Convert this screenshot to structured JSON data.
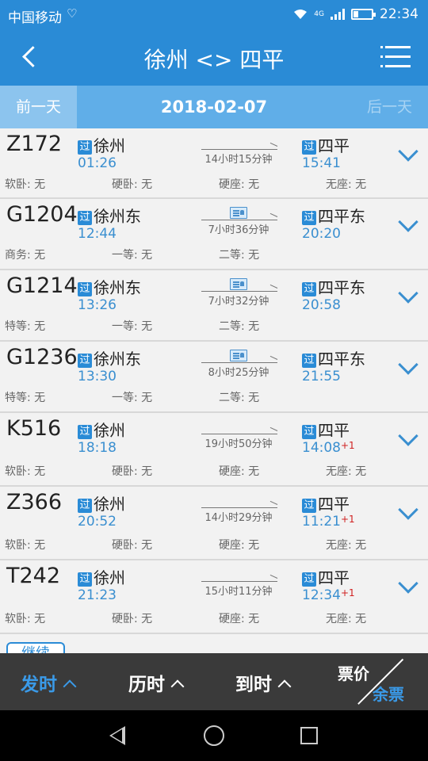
{
  "status": {
    "carrier": "中国移动",
    "net": "4G",
    "time": "22:34"
  },
  "header": {
    "title": "徐州 <> 四平"
  },
  "datebar": {
    "prev": "前一天",
    "date": "2018-02-07",
    "next": "后一天"
  },
  "badge": "过",
  "trains": [
    {
      "num": "Z172",
      "from": "徐州",
      "dep": "01:26",
      "duration": "14小时15分钟",
      "to": "四平",
      "arr": "15:41",
      "plus": "",
      "ticket_icon": false,
      "seats": [
        "软卧: 无",
        "硬卧: 无",
        "硬座: 无",
        "无座: 无"
      ]
    },
    {
      "num": "G1204",
      "from": "徐州东",
      "dep": "12:44",
      "duration": "7小时36分钟",
      "to": "四平东",
      "arr": "20:20",
      "plus": "",
      "ticket_icon": true,
      "seats": [
        "商务: 无",
        "一等: 无",
        "二等: 无",
        ""
      ]
    },
    {
      "num": "G1214",
      "from": "徐州东",
      "dep": "13:26",
      "duration": "7小时32分钟",
      "to": "四平东",
      "arr": "20:58",
      "plus": "",
      "ticket_icon": true,
      "seats": [
        "特等: 无",
        "一等: 无",
        "二等: 无",
        ""
      ]
    },
    {
      "num": "G1236",
      "from": "徐州东",
      "dep": "13:30",
      "duration": "8小时25分钟",
      "to": "四平东",
      "arr": "21:55",
      "plus": "",
      "ticket_icon": true,
      "seats": [
        "特等: 无",
        "一等: 无",
        "二等: 无",
        ""
      ]
    },
    {
      "num": "K516",
      "from": "徐州",
      "dep": "18:18",
      "duration": "19小时50分钟",
      "to": "四平",
      "arr": "14:08",
      "plus": "+1",
      "ticket_icon": false,
      "seats": [
        "软卧: 无",
        "硬卧: 无",
        "硬座: 无",
        "无座: 无"
      ]
    },
    {
      "num": "Z366",
      "from": "徐州",
      "dep": "20:52",
      "duration": "14小时29分钟",
      "to": "四平",
      "arr": "11:21",
      "plus": "+1",
      "ticket_icon": false,
      "seats": [
        "软卧: 无",
        "硬卧: 无",
        "硬座: 无",
        "无座: 无"
      ]
    },
    {
      "num": "T242",
      "from": "徐州",
      "dep": "21:23",
      "duration": "15小时11分钟",
      "to": "四平",
      "arr": "12:34",
      "plus": "+1",
      "ticket_icon": false,
      "seats": [
        "软卧: 无",
        "硬卧: 无",
        "硬座: 无",
        "无座: 无"
      ]
    }
  ],
  "more_button": "继续",
  "sort": {
    "depart": "发时",
    "duration": "历时",
    "arrive": "到时",
    "price": "票价",
    "remaining": "余票"
  },
  "colors": {
    "primary": "#2a8bd6",
    "accent": "#3a9ae8",
    "next_day": "#d02020"
  }
}
